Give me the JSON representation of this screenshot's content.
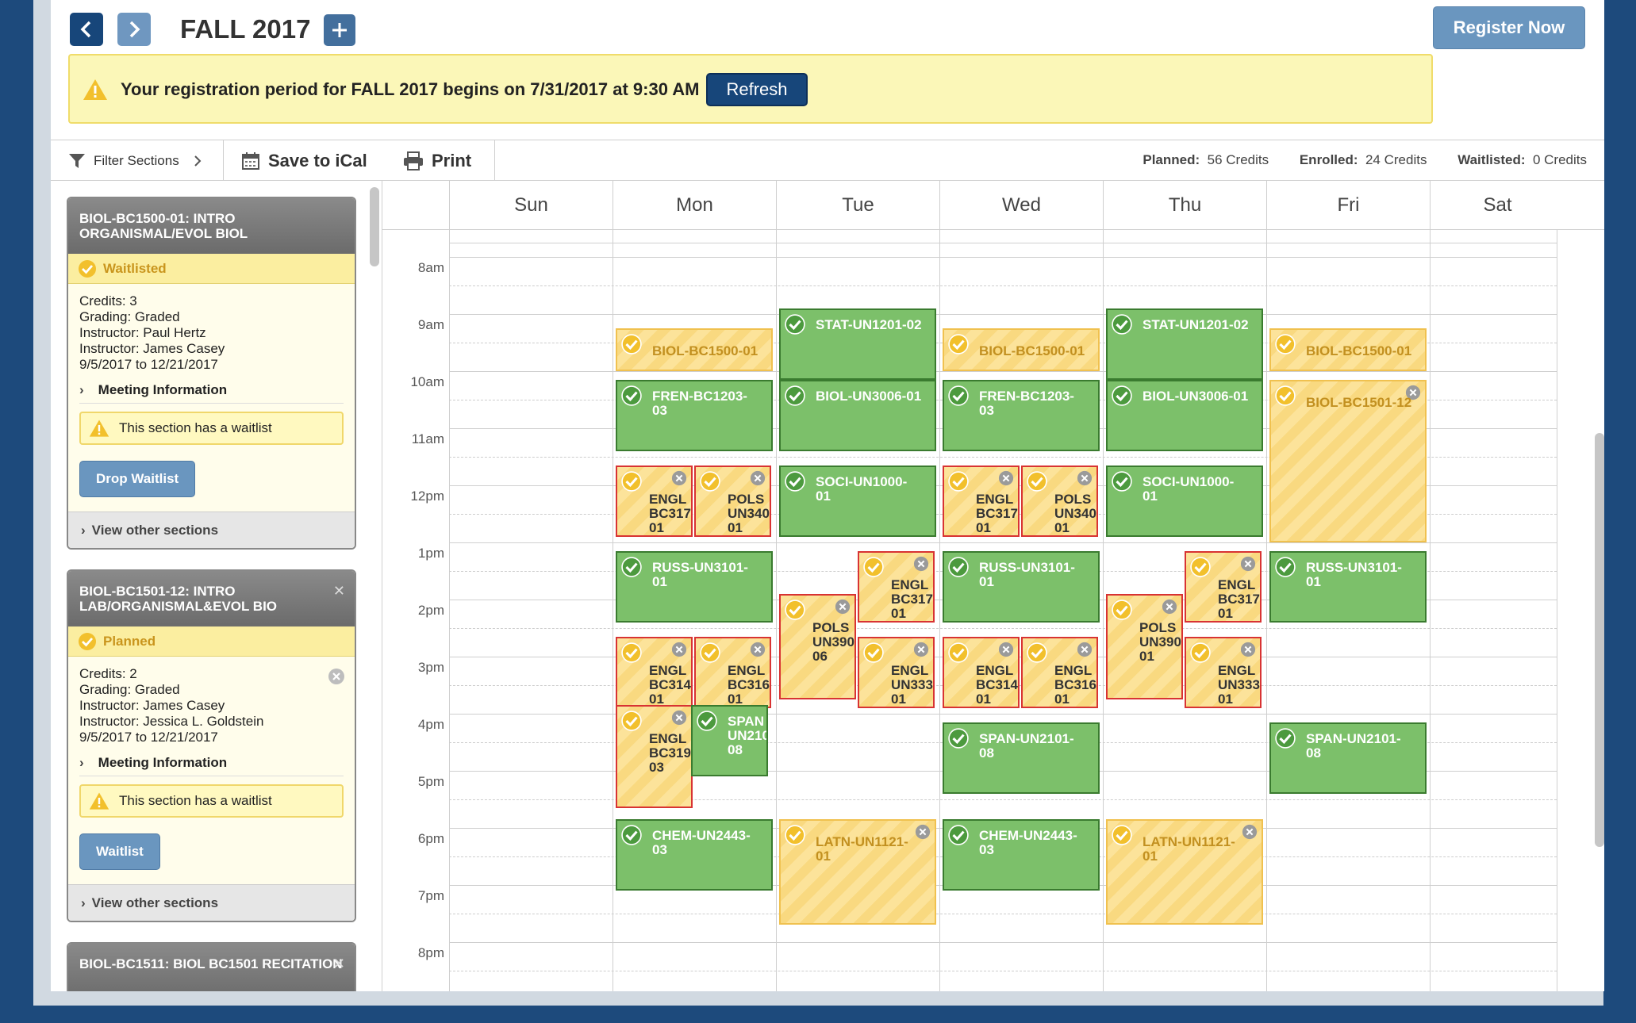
{
  "header": {
    "term": "FALL 2017",
    "register_label": "Register Now",
    "notice": "Your registration period for FALL 2017 begins on 7/31/2017 at 9:30 AM",
    "refresh_label": "Refresh"
  },
  "toolbar": {
    "filter_label": "Filter Sections",
    "ical_label": "Save to iCal",
    "print_label": "Print",
    "planned_label": "Planned:",
    "planned_value": "56 Credits",
    "enrolled_label": "Enrolled:",
    "enrolled_value": "24 Credits",
    "waitlisted_label": "Waitlisted:",
    "waitlisted_value": "0 Credits"
  },
  "cards": [
    {
      "title": "BIOL-BC1500-01: INTRO ORGANISMAL/EVOL BIOL",
      "status": "Waitlisted",
      "credits": "Credits: 3",
      "grading": "Grading: Graded",
      "instructor1": "Instructor: Paul Hertz",
      "instructor2": "Instructor: James Casey",
      "dates": "9/5/2017 to 12/21/2017",
      "meeting": "Meeting Information",
      "warning": "This section has a waitlist",
      "action": "Drop Waitlist",
      "view_other": "View other sections"
    },
    {
      "title": "BIOL-BC1501-12: INTRO LAB/ORGANISMAL&EVOL BIO",
      "status": "Planned",
      "credits": "Credits: 2",
      "grading": "Grading: Graded",
      "instructor1": "Instructor: James Casey",
      "instructor2": "Instructor: Jessica L. Goldstein",
      "dates": "9/5/2017 to 12/21/2017",
      "meeting": "Meeting Information",
      "warning": "This section has a waitlist",
      "action": "Waitlist",
      "view_other": "View other sections"
    },
    {
      "title": "BIOL-BC1511: BIOL BC1501 RECITATION"
    }
  ],
  "days": [
    "Sun",
    "Mon",
    "Tue",
    "Wed",
    "Thu",
    "Fri",
    "Sat"
  ],
  "times": [
    "8am",
    "9am",
    "10am",
    "11am",
    "12pm",
    "1pm",
    "2pm",
    "3pm",
    "4pm",
    "5pm",
    "6pm",
    "7pm",
    "8pm"
  ],
  "events": [
    {
      "label": "BIOL-BC1500-01"
    },
    {
      "label": "FREN-BC1203-\n03"
    },
    {
      "label": "ENGL\nBC317\n01"
    },
    {
      "label": "POLS\nUN340\n01"
    },
    {
      "label": "RUSS-UN3101-\n01"
    },
    {
      "label": "ENGL\nBC314\n01"
    },
    {
      "label": "ENGL\nBC316\n01"
    },
    {
      "label": "ENGL\nBC319\n03"
    },
    {
      "label": "SPAN\nUN210\n08"
    },
    {
      "label": "CHEM-UN2443-\n03"
    },
    {
      "label": "STAT-UN1201-02"
    },
    {
      "label": "BIOL-UN3006-01"
    },
    {
      "label": "SOCI-UN1000-\n01"
    },
    {
      "label": "ENGL\nBC317\n01"
    },
    {
      "label": "POLS\nUN390\n06"
    },
    {
      "label": "ENGL\nUN333\n01"
    },
    {
      "label": "LATN-UN1121-\n01"
    },
    {
      "label": "BIOL-BC1500-01"
    },
    {
      "label": "FREN-BC1203-\n03"
    },
    {
      "label": "ENGL\nBC317\n01"
    },
    {
      "label": "POLS\nUN340\n01"
    },
    {
      "label": "RUSS-UN3101-\n01"
    },
    {
      "label": "ENGL\nBC314\n01"
    },
    {
      "label": "ENGL\nBC316\n01"
    },
    {
      "label": "SPAN-UN2101-\n08"
    },
    {
      "label": "CHEM-UN2443-\n03"
    },
    {
      "label": "STAT-UN1201-02"
    },
    {
      "label": "BIOL-UN3006-01"
    },
    {
      "label": "SOCI-UN1000-\n01"
    },
    {
      "label": "ENGL\nBC317\n01"
    },
    {
      "label": "POLS\nUN390\n01"
    },
    {
      "label": "ENGL\nUN333\n01"
    },
    {
      "label": "LATN-UN1121-\n01"
    },
    {
      "label": "BIOL-BC1500-01"
    },
    {
      "label": "BIOL-BC1501-12"
    },
    {
      "label": "RUSS-UN3101-\n01"
    },
    {
      "label": "SPAN-UN2101-\n08"
    }
  ],
  "colors": {
    "enrolled": "#7cc06a",
    "planned": "#fce39a",
    "conflict": "#d83333",
    "navy": "#17467a"
  }
}
